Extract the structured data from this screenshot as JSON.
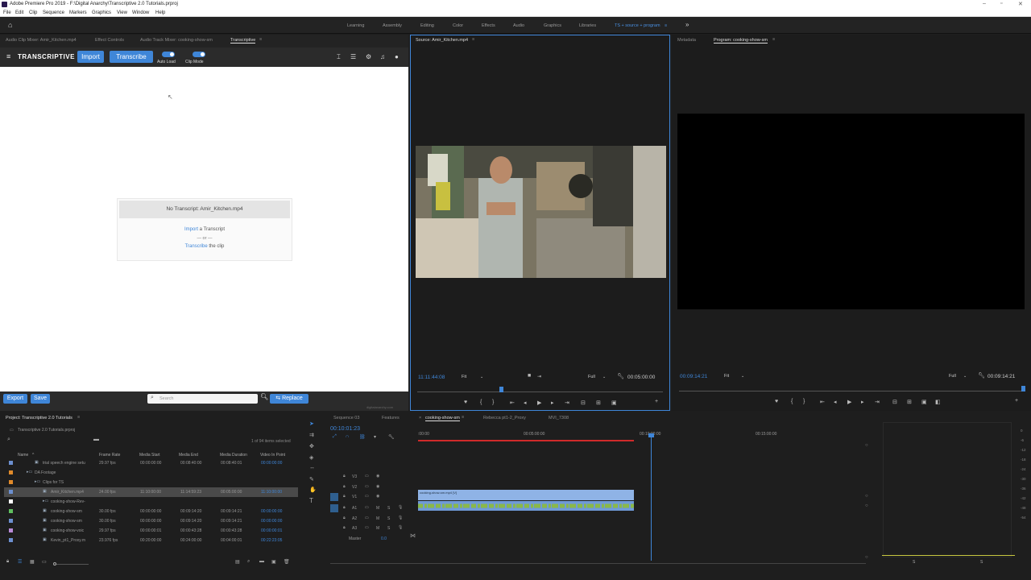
{
  "app": {
    "title": "Adobe Premiere Pro 2019 - F:\\Digital Anarchy\\Transcriptive 2.0 Tutorials.prproj",
    "menus": [
      "File",
      "Edit",
      "Clip",
      "Sequence",
      "Markers",
      "Graphics",
      "View",
      "Window",
      "Help"
    ]
  },
  "workspaces": [
    "Learning",
    "Assembly",
    "Editing",
    "Color",
    "Effects",
    "Audio",
    "Graphics",
    "Libraries",
    "TS + source + program"
  ],
  "left_tabs": [
    "Audio Clip Mixer: Amir_Kitchen.mp4",
    "Effect Controls",
    "Audio Track Mixer: cooking-show-sm",
    "Transcriptive"
  ],
  "transcriptive": {
    "brand": "TRANSCRIPTIVE",
    "import": "Import",
    "transcribe": "Transcribe",
    "auto_load": "Auto Load",
    "clip_mode": "Clip Mode",
    "no_transcript": "No Transcript: Amir_Kitchen.mp4",
    "import_link": "Import",
    "import_rest": " a Transcript",
    "or": "— or —",
    "transcribe_link": "Transcribe",
    "transcribe_rest": " the clip",
    "export": "Export",
    "save": "Save",
    "search_placeholder": "Search",
    "replace": "Replace",
    "credit": "digitalanarchy.com"
  },
  "source": {
    "tab": "Source: Amir_Kitchen.mp4",
    "tc_left": "11:11:44:08",
    "fit": "Fit",
    "quality": "Full",
    "tc_right": "00:05:00:00"
  },
  "program": {
    "tabs": [
      "Metadata",
      "Program: cooking-show-sm"
    ],
    "tc_left": "00:09:14:21",
    "fit": "Fit",
    "quality": "Full",
    "tc_right": "00:09:14:21"
  },
  "project": {
    "tab": "Project: Transcriptive 2.0 Tutorials",
    "file": "Transcriptive 2.0 Tutorials.prproj",
    "count": "1 of 94 items selected",
    "headers": [
      "Name",
      "Frame Rate",
      "Media Start",
      "Media End",
      "Media Duration",
      "Video In Point"
    ],
    "rows": [
      {
        "name": "trial speech engine setu",
        "fr": "29.97 fps",
        "ms": "00:00:00:00",
        "me": "00:08:40:00",
        "md": "00:08:40:01",
        "vi": "00:00:00:00",
        "color": "#6c8fd0",
        "indent": 2
      },
      {
        "name": "DA Footage",
        "fr": "",
        "ms": "",
        "me": "",
        "md": "",
        "vi": "",
        "color": "#e08a2a",
        "indent": 1
      },
      {
        "name": "Clips for TS",
        "fr": "",
        "ms": "",
        "me": "",
        "md": "",
        "vi": "",
        "color": "#e08a2a",
        "indent": 2
      },
      {
        "name": "Amir_Kitchen.mp4",
        "fr": "24.00 fps",
        "ms": "11:10:00:00",
        "me": "11:14:59:23",
        "md": "00:05:00:00",
        "vi": "11:10:00:00",
        "color": "#6c8fd0",
        "indent": 3,
        "sel": true
      },
      {
        "name": "cooking-show-Rev-",
        "fr": "",
        "ms": "",
        "me": "",
        "md": "",
        "vi": "",
        "color": "#ffffff",
        "indent": 3
      },
      {
        "name": "cooking-show-sm",
        "fr": "30.00 fps",
        "ms": "00:00:00:00",
        "me": "00:09:14:20",
        "md": "00:09:14:21",
        "vi": "00:00:00:00",
        "color": "#5fbf5f",
        "indent": 3
      },
      {
        "name": "cooking-show-sm",
        "fr": "30.00 fps",
        "ms": "00:00:00:00",
        "me": "00:09:14:20",
        "md": "00:09:14:21",
        "vi": "00:00:00:00",
        "color": "#6c8fd0",
        "indent": 3
      },
      {
        "name": "cooking-show-voic",
        "fr": "29.97 fps",
        "ms": "00:00:00:01",
        "me": "00:00:43:28",
        "md": "00:00:43:28",
        "vi": "00:00:00:01",
        "color": "#b98ad8",
        "indent": 3
      },
      {
        "name": "Kevin_pt1_Proxy.m",
        "fr": "23.976 fps",
        "ms": "00:20:00:00",
        "me": "00:24:00:00",
        "md": "00:04:00:01",
        "vi": "00:22:23:05",
        "color": "#6c8fd0",
        "indent": 3
      }
    ]
  },
  "timeline": {
    "tabs": [
      "Sequence 03",
      "Features",
      "cooking-show-sm",
      "Rebecca pt1-2_Proxy",
      "MVI_7308"
    ],
    "tc": "00:10:01:23",
    "ruler": [
      ":00:00",
      "00:05:00:00",
      "00:10:00:00",
      "00:15:00:00"
    ],
    "tracks": [
      "V3",
      "V2",
      "V1",
      "A1",
      "A2",
      "A3"
    ],
    "master": "Master",
    "master_val": "0.0",
    "clip_name": "cooking-show-sm.mp4 [V]"
  },
  "meter": {
    "labels": [
      "0",
      "-6",
      "-12",
      "-18",
      "-24",
      "-30",
      "-36",
      "-42",
      "-48",
      "-54"
    ],
    "s_labels": [
      "S",
      "S"
    ]
  }
}
